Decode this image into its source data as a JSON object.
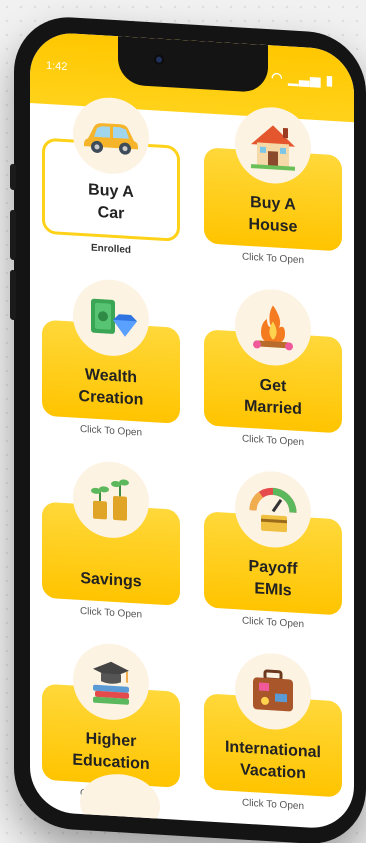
{
  "status": {
    "time": "1:42"
  },
  "goals": [
    {
      "id": "buy-a-car",
      "label": "Buy A\nCar",
      "status": "Enrolled",
      "enrolled": true,
      "icon": "car-icon"
    },
    {
      "id": "buy-a-house",
      "label": "Buy A\nHouse",
      "status": "Click To Open",
      "enrolled": false,
      "icon": "house-icon"
    },
    {
      "id": "wealth-creation",
      "label": "Wealth\nCreation",
      "status": "Click To Open",
      "enrolled": false,
      "icon": "money-diamond-icon"
    },
    {
      "id": "get-married",
      "label": "Get\nMarried",
      "status": "Click To Open",
      "enrolled": false,
      "icon": "wedding-fire-icon"
    },
    {
      "id": "savings",
      "label": "Savings",
      "status": "Click To Open",
      "enrolled": false,
      "icon": "coin-plant-icon"
    },
    {
      "id": "payoff-emis",
      "label": "Payoff\nEMIs",
      "status": "Click To Open",
      "enrolled": false,
      "icon": "gauge-card-icon"
    },
    {
      "id": "higher-education",
      "label": "Higher\nEducation",
      "status": "Click To Open",
      "enrolled": false,
      "icon": "graduation-books-icon"
    },
    {
      "id": "international-vacation",
      "label": "International\nVacation",
      "status": "Click To Open",
      "enrolled": false,
      "icon": "suitcase-icon"
    }
  ],
  "colors": {
    "accent": "#ffc700",
    "card": "#ffd21a",
    "frame": "#141414"
  }
}
